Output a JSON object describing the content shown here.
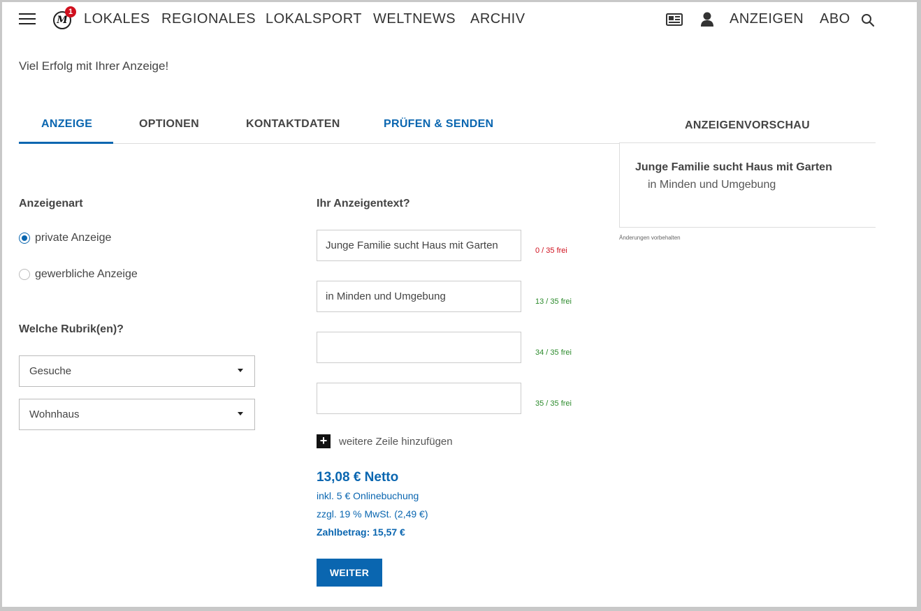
{
  "logo": {
    "letter": "M",
    "badge": "1"
  },
  "nav": {
    "items": [
      "LOKALES",
      "REGIONALES",
      "LOKALSPORT",
      "WELTNEWS",
      "ARCHIV"
    ],
    "anzeigen": "ANZEIGEN",
    "abo": "ABO"
  },
  "welcome": "Viel Erfolg mit Ihrer Anzeige!",
  "tabs": [
    "ANZEIGE",
    "OPTIONEN",
    "KONTAKTDATEN",
    "PRÜFEN & SENDEN"
  ],
  "active_tab": "ANZEIGE",
  "accent_color": "#0a66b0",
  "anzeigenart": {
    "title": "Anzeigenart",
    "options": [
      "private Anzeige",
      "gewerbliche Anzeige"
    ],
    "selected": "private Anzeige"
  },
  "rubrik": {
    "title": "Welche Rubrik(en)?",
    "select1": "Gesuche",
    "select2": "Wohnhaus"
  },
  "text": {
    "title": "Ihr Anzeigentext?",
    "lines": [
      {
        "value": "Junge Familie sucht Haus mit Garten",
        "counter": "0 / 35 frei"
      },
      {
        "value": "in Minden und Umgebung",
        "counter": "13 / 35 frei"
      },
      {
        "value": "",
        "counter": "34 / 35 frei"
      },
      {
        "value": "",
        "counter": "35 / 35 frei"
      }
    ],
    "add_line": "weitere Zeile hinzufügen"
  },
  "price": {
    "main": "13,08 € Netto",
    "online": "inkl. 5 € Onlinebuchung",
    "tax": "zzgl. 19 % MwSt. (2,49 €)",
    "total": "Zahlbetrag: 15,57 €"
  },
  "button": {
    "weiter": "WEITER"
  },
  "preview": {
    "title": "ANZEIGENVORSCHAU",
    "line1": "Junge Familie sucht Haus mit Garten",
    "line2": "in Minden und Umgebung",
    "note": "Änderungen vorbehalten"
  }
}
